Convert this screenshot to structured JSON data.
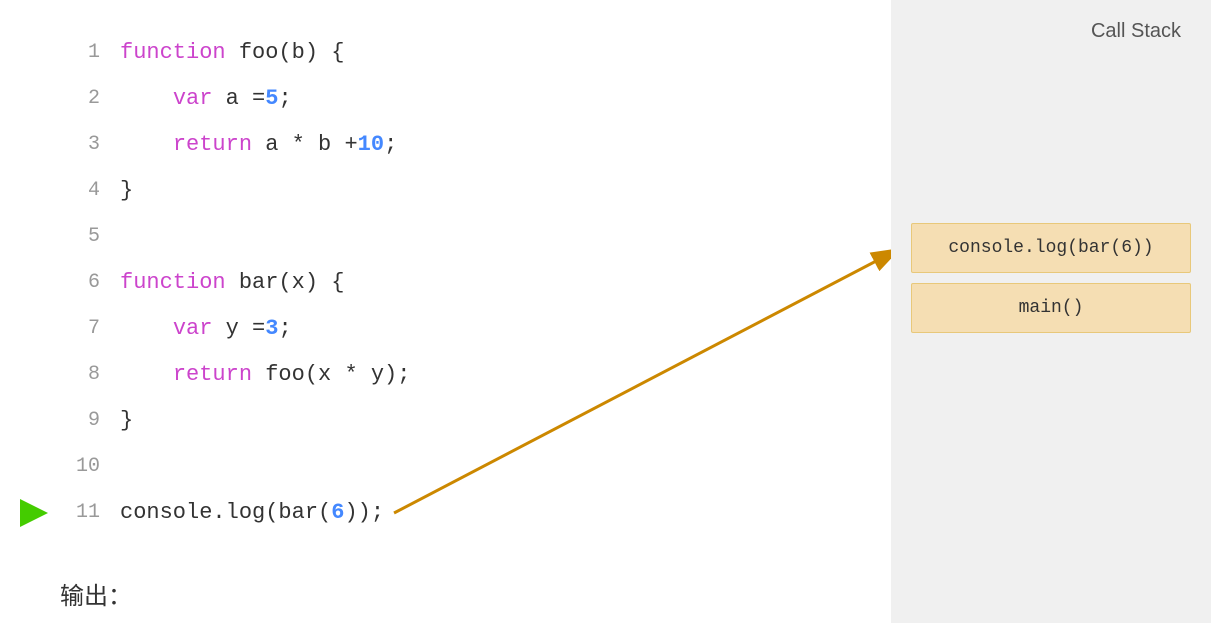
{
  "callStack": {
    "title": "Call Stack",
    "items": [
      {
        "label": "console.log(bar(6))"
      },
      {
        "label": "main()"
      }
    ]
  },
  "code": {
    "lines": [
      {
        "num": 1,
        "content": "function foo(b) {"
      },
      {
        "num": 2,
        "content": "    var a = 5;"
      },
      {
        "num": 3,
        "content": "    return a * b + 10;"
      },
      {
        "num": 4,
        "content": "}"
      },
      {
        "num": 5,
        "content": ""
      },
      {
        "num": 6,
        "content": "function bar(x) {"
      },
      {
        "num": 7,
        "content": "    var y = 3;"
      },
      {
        "num": 8,
        "content": "    return foo(x * y);"
      },
      {
        "num": 9,
        "content": "}"
      },
      {
        "num": 10,
        "content": ""
      },
      {
        "num": 11,
        "content": "console.log(bar(6));",
        "current": true
      }
    ]
  },
  "output": {
    "label": "输出："
  }
}
